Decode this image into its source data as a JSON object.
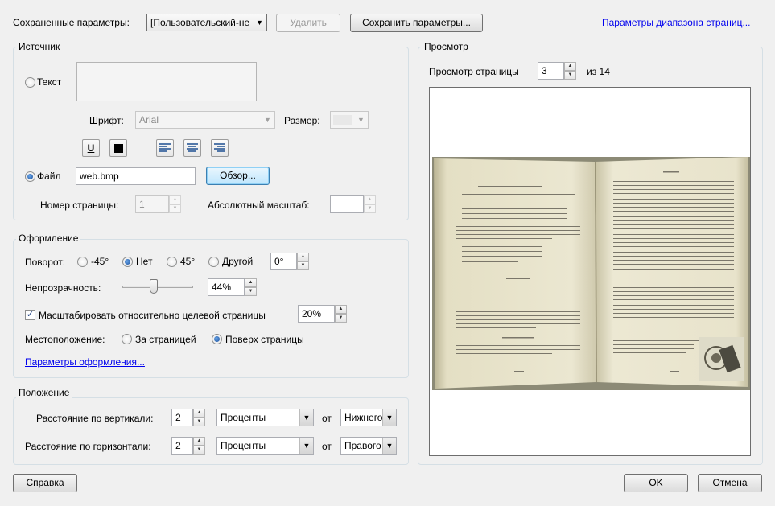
{
  "header": {
    "saved_label": "Сохраненные параметры:",
    "saved_value": "[Пользовательский-не",
    "delete_label": "Удалить",
    "save_label": "Сохранить параметры...",
    "range_link": "Параметры диапазона страниц..."
  },
  "source": {
    "title": "Источник",
    "text_radio": "Текст",
    "font_label": "Шрифт:",
    "font_value": "Arial",
    "size_label": "Размер:",
    "file_radio": "Файл",
    "file_value": "web.bmp",
    "browse_label": "Обзор...",
    "page_label": "Номер страницы:",
    "page_value": "1",
    "abs_scale_label": "Абсолютный масштаб:"
  },
  "appearance": {
    "title": "Оформление",
    "rotation_label": "Поворот:",
    "rot_m45": "-45°",
    "rot_none": "Нет",
    "rot_45": "45°",
    "rot_other": "Другой",
    "rot_value": "0°",
    "opacity_label": "Непрозрачность:",
    "opacity_value": "44%",
    "opacity_level": 0.44,
    "scale_label": "Масштабировать относительно целевой страницы",
    "scale_value": "20%",
    "location_label": "Местоположение:",
    "loc_behind": "За страницей",
    "loc_front": "Поверх страницы",
    "options_link": "Параметры оформления..."
  },
  "position": {
    "title": "Положение",
    "vertical_label": "Расстояние по вертикали:",
    "vertical_value": "2",
    "vertical_units": "Проценты",
    "from_label_1": "от",
    "vertical_anchor": "Нижнего",
    "horizontal_label": "Расстояние по горизонтали:",
    "horizontal_value": "2",
    "horizontal_units": "Проценты",
    "from_label_2": "от",
    "horizontal_anchor": "Правого"
  },
  "preview": {
    "title": "Просмотр",
    "page_label": "Просмотр страницы",
    "page_value": "3",
    "of_label": "из 14",
    "book_left_heading": "GUNA AND VRDDHI SUBSTITUTIONS",
    "book_right_heading": "Vowels",
    "book_left_subheading": "SANDHI",
    "book_left_subheading_2": "External Sandhi",
    "book_page_marker": "[ 2 ]"
  },
  "footer": {
    "help_label": "Справка",
    "ok_label": "OK",
    "cancel_label": "Отмена"
  }
}
